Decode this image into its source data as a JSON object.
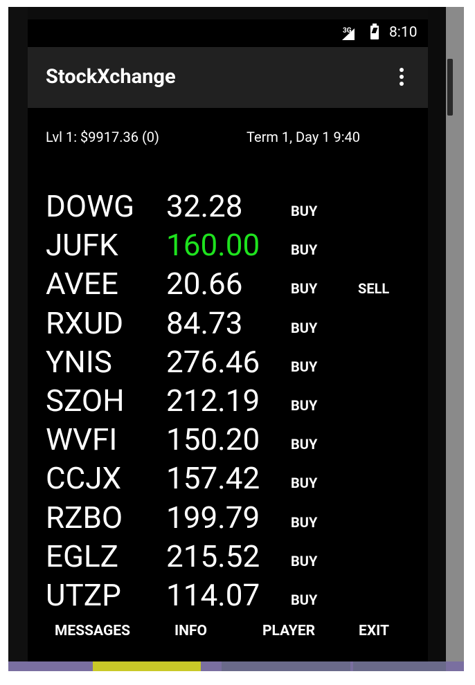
{
  "status_bar": {
    "network": "3G",
    "time": "8:10"
  },
  "app_bar": {
    "title": "StockXchange",
    "menu_icon": "overflow-menu-icon"
  },
  "info": {
    "level_balance": "Lvl 1: $9917.36 (0)",
    "term_day_time": "Term 1, Day 1  9:40"
  },
  "stocks": [
    {
      "symbol": "DOWG",
      "price": "32.28",
      "buy": "BUY",
      "sell": ""
    },
    {
      "symbol": "JUFK",
      "price": "160.00",
      "buy": "BUY",
      "sell": ""
    },
    {
      "symbol": "AVEE",
      "price": "20.66",
      "buy": "BUY",
      "sell": "SELL"
    },
    {
      "symbol": "RXUD",
      "price": "84.73",
      "buy": "BUY",
      "sell": ""
    },
    {
      "symbol": "YNIS",
      "price": "276.46",
      "buy": "BUY",
      "sell": ""
    },
    {
      "symbol": "SZOH",
      "price": "212.19",
      "buy": "BUY",
      "sell": ""
    },
    {
      "symbol": "WVFI",
      "price": "150.20",
      "buy": "BUY",
      "sell": ""
    },
    {
      "symbol": "CCJX",
      "price": "157.42",
      "buy": "BUY",
      "sell": ""
    },
    {
      "symbol": "RZBO",
      "price": "199.79",
      "buy": "BUY",
      "sell": ""
    },
    {
      "symbol": "EGLZ",
      "price": "215.52",
      "buy": "BUY",
      "sell": ""
    },
    {
      "symbol": "UTZP",
      "price": "114.07",
      "buy": "BUY",
      "sell": ""
    }
  ],
  "highlight_color": "#1ee21e",
  "bottom_nav": {
    "messages": "MESSAGES",
    "info": "INFO",
    "player": "PLAYER",
    "exit": "EXIT"
  }
}
